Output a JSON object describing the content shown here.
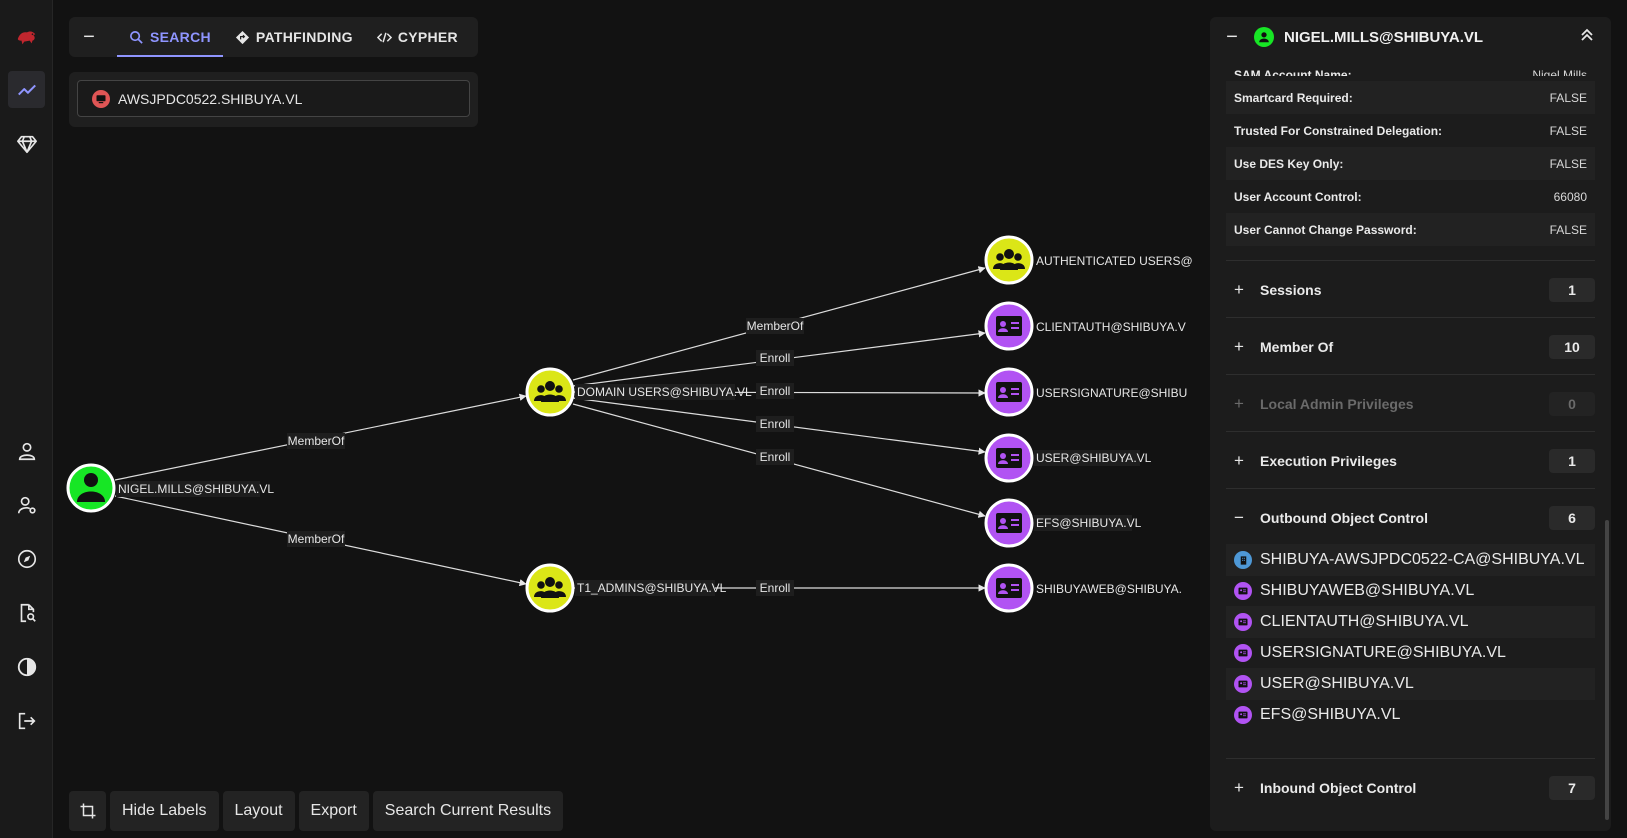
{
  "tabs": [
    {
      "label": "SEARCH",
      "icon": "search-icon",
      "active": true
    },
    {
      "label": "PATHFINDING",
      "icon": "diamond-direction-icon",
      "active": false
    },
    {
      "label": "CYPHER",
      "icon": "code-icon",
      "active": false
    }
  ],
  "search": {
    "value": "AWSJPDC0522.SHIBUYA.VL",
    "icon": "computer-node-icon"
  },
  "rail_icons": [
    "bloodhound-logo",
    "graph-icon",
    "gem-icon",
    "user-icon",
    "user-gear-icon",
    "compass-icon",
    "file-search-icon",
    "contrast-icon",
    "logout-icon"
  ],
  "colors": {
    "user_node": "#17e625",
    "group_node": "#dbe617",
    "template_node": "#b153f3",
    "ca_node": "#4e98d6",
    "computer_node": "#e05555",
    "accent": "#8f95ff"
  },
  "graph": {
    "nodes": {
      "nigel": "NIGEL.MILLS@SHIBUYA.VL",
      "domain_users": "DOMAIN USERS@SHIBUYA.VL",
      "t1_admins": "T1_ADMINS@SHIBUYA.VL",
      "auth_users": "AUTHENTICATED USERS@",
      "clientauth": "CLIENTAUTH@SHIBUYA.V",
      "usersignature": "USERSIGNATURE@SHIBU",
      "user": "USER@SHIBUYA.VL",
      "efs": "EFS@SHIBUYA.VL",
      "shibuyaweb": "SHIBUYAWEB@SHIBUYA."
    },
    "edges": {
      "memberof": "MemberOf",
      "enroll": "Enroll"
    },
    "offscreen_fragment": "AWS"
  },
  "toolbar": {
    "hide_labels": "Hide Labels",
    "layout": "Layout",
    "export": "Export",
    "search_results": "Search Current Results"
  },
  "panel": {
    "title": "NIGEL.MILLS@SHIBUYA.VL",
    "partial_row": {
      "key": "SAM Account Name:",
      "value": "Nigel.Mills"
    },
    "properties": [
      {
        "key": "Smartcard Required:",
        "value": "FALSE"
      },
      {
        "key": "Trusted For Constrained Delegation:",
        "value": "FALSE"
      },
      {
        "key": "Use DES Key Only:",
        "value": "FALSE"
      },
      {
        "key": "User Account Control:",
        "value": "66080"
      },
      {
        "key": "User Cannot Change Password:",
        "value": "FALSE"
      }
    ],
    "sections": [
      {
        "label": "Sessions",
        "count": "1",
        "sign": "+"
      },
      {
        "label": "Member Of",
        "count": "10",
        "sign": "+"
      },
      {
        "label": "Local Admin Privileges",
        "count": "0",
        "sign": "+"
      },
      {
        "label": "Execution Privileges",
        "count": "1",
        "sign": "+"
      },
      {
        "label": "Outbound Object Control",
        "count": "6",
        "sign": "−"
      }
    ],
    "outbound_objects": [
      {
        "name": "SHIBUYA-AWSJPDC0522-CA@SHIBUYA.VL",
        "icon": "certificate-authority-icon"
      },
      {
        "name": "SHIBUYAWEB@SHIBUYA.VL",
        "icon": "cert-template-icon"
      },
      {
        "name": "CLIENTAUTH@SHIBUYA.VL",
        "icon": "cert-template-icon"
      },
      {
        "name": "USERSIGNATURE@SHIBUYA.VL",
        "icon": "cert-template-icon"
      },
      {
        "name": "USER@SHIBUYA.VL",
        "icon": "cert-template-icon"
      },
      {
        "name": "EFS@SHIBUYA.VL",
        "icon": "cert-template-icon"
      }
    ],
    "inbound": {
      "label": "Inbound Object Control",
      "count": "7",
      "sign": "+"
    }
  }
}
